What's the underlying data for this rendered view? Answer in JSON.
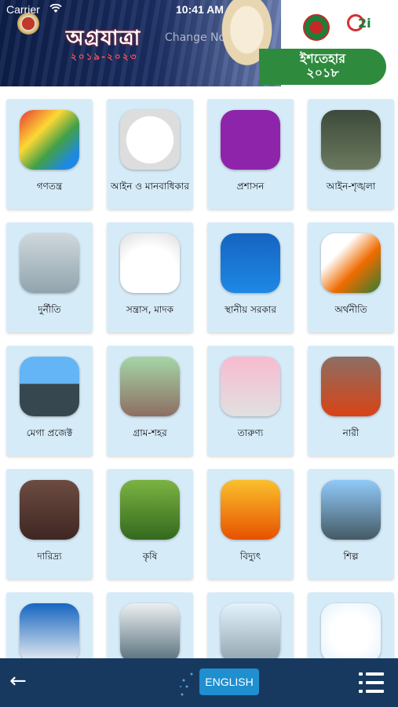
{
  "status_bar": {
    "carrier": "Carrier",
    "time": "10:41 AM"
  },
  "header": {
    "title": "অগ্রযাত্রা",
    "years": "২০১৯-২০২৩",
    "ghost_text": "Change Now",
    "manifesto_line1": "ইশতেহার",
    "manifesto_line2": "২০১৮"
  },
  "tiles": [
    {
      "label": "গণতন্ত্র",
      "icon": "hands-icon"
    },
    {
      "label": "আইন ও মানবাধিকার",
      "icon": "scales-icon"
    },
    {
      "label": "প্রশাসন",
      "icon": "network-icon"
    },
    {
      "label": "আইন-শৃঙ্খলা",
      "icon": "police-icon"
    },
    {
      "label": "দুর্নীতি",
      "icon": "ballot-icon"
    },
    {
      "label": "সন্ত্রাস, মাদক",
      "icon": "drug-meter-icon"
    },
    {
      "label": "স্থানীয় সরকার",
      "icon": "government-building-icon"
    },
    {
      "label": "অর্থনীতি",
      "icon": "growth-chart-icon"
    },
    {
      "label": "মেগা প্রজেক্ট",
      "icon": "bridge-train-icon"
    },
    {
      "label": "গ্রাম-শহর",
      "icon": "village-icon"
    },
    {
      "label": "তারুণ্য",
      "icon": "youth-icon"
    },
    {
      "label": "নারী",
      "icon": "women-icon"
    },
    {
      "label": "দারিদ্র্য",
      "icon": "poverty-icon"
    },
    {
      "label": "কৃষি",
      "icon": "agriculture-icon"
    },
    {
      "label": "বিদ্যুৎ",
      "icon": "power-tower-icon"
    },
    {
      "label": "শিল্প",
      "icon": "industry-icon"
    },
    {
      "label": "",
      "icon": "worker-icon"
    },
    {
      "label": "",
      "icon": "students-icon"
    },
    {
      "label": "",
      "icon": "health-icon"
    },
    {
      "label": "",
      "icon": "digital-icon"
    }
  ],
  "bottom_bar": {
    "language_button": "ENGLISH"
  },
  "colors": {
    "tile_bg": "#d6ebf8",
    "bottom_bar": "#17395f",
    "manifesto_green": "#2e8b3e",
    "language_button": "#1f8fcf"
  }
}
